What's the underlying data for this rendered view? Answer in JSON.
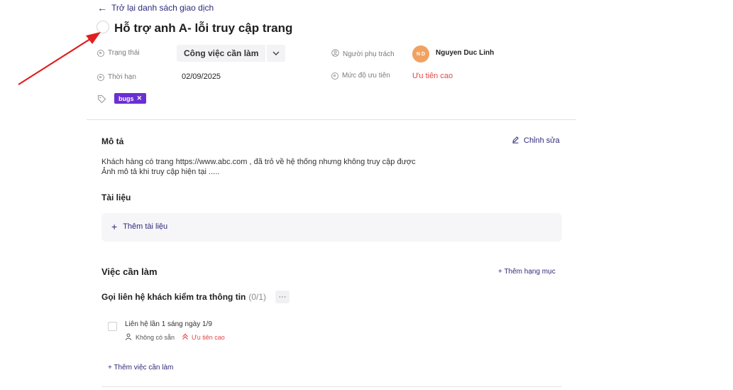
{
  "back_link": {
    "label": "Trở lại danh sách giao dịch"
  },
  "task": {
    "title": "Hỗ trợ anh A- lỗi truy cập trang"
  },
  "fields": {
    "status": {
      "label": "Trạng thái",
      "value": "Công việc cần làm"
    },
    "owner": {
      "label": "Người phụ trách",
      "initials": "N D",
      "name": "Nguyen Duc Linh"
    },
    "deadline": {
      "label": "Thời hạn",
      "value": "02/09/2025"
    },
    "priority": {
      "label": "Mức độ ưu tiên",
      "value": "Ưu tiên cao"
    },
    "tags": [
      {
        "label": "bugs",
        "color": "#6a2fd4"
      }
    ]
  },
  "description": {
    "heading": "Mô tả",
    "edit_label": "Chỉnh sửa",
    "lines": [
      "Khách hàng có trang https://www.abc.com , đã trỏ về hệ thống nhưng không truy cập được",
      "Ảnh mô tả khi truy cập hiện tại ....."
    ]
  },
  "documents": {
    "heading": "Tài liệu",
    "add_label": "Thêm tài liệu"
  },
  "todo": {
    "heading": "Việc cần làm",
    "add_category_label": "+ Thêm hạng mục",
    "group": {
      "title": "Gọi liên hệ khách kiểm tra thông tin",
      "count": "(0/1)",
      "more": "···",
      "items": [
        {
          "text": "Liên hệ lần 1 sáng ngày 1/9",
          "assignee": "Không có sẵn",
          "priority": "Ưu tiên cao"
        }
      ]
    },
    "add_task_label": "+ Thêm việc cần làm"
  },
  "colors": {
    "accent": "#2f2a7a",
    "priority": "#e04848",
    "tag": "#6a2fd4",
    "avatar": "#f0a262"
  }
}
